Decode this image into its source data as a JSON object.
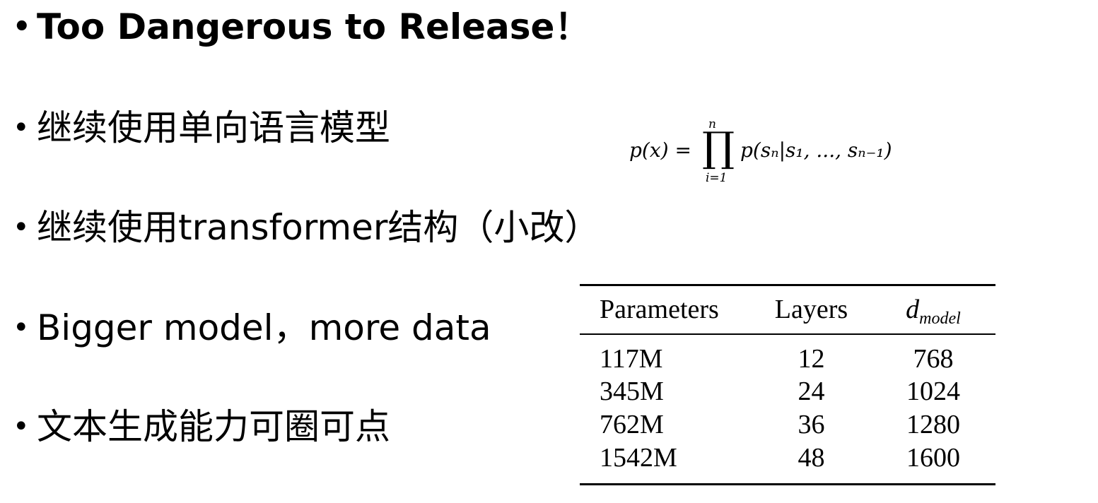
{
  "bullets": [
    {
      "text": "Too Dangerous to Release！",
      "bold": true
    },
    {
      "text": "继续使用单向语言模型"
    },
    {
      "text": "继续使用transformer结构（小改）"
    },
    {
      "text": "Bigger model，more data"
    },
    {
      "text": "文本生成能力可圈可点"
    }
  ],
  "formula": {
    "lhs": "p(x) = ",
    "product_symbol": "∏",
    "upper": "n",
    "lower": "i=1",
    "rhs": "p(sₙ|s₁, ..., sₙ₋₁)"
  },
  "table": {
    "headers": [
      "Parameters",
      "Layers",
      "d",
      "model"
    ],
    "rows": [
      [
        "117M",
        "12",
        "768"
      ],
      [
        "345M",
        "24",
        "1024"
      ],
      [
        "762M",
        "36",
        "1280"
      ],
      [
        "1542M",
        "48",
        "1600"
      ]
    ]
  }
}
